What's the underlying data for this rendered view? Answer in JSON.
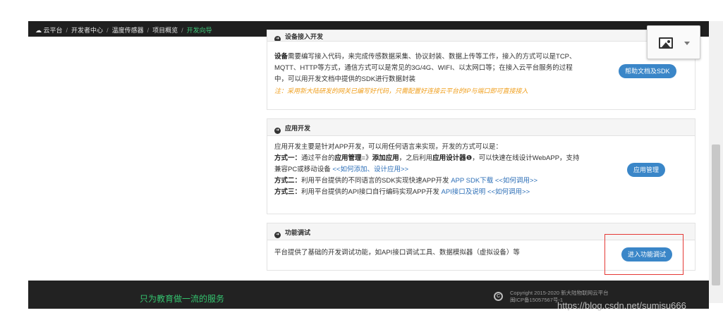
{
  "breadcrumb": {
    "home_icon": "cloud-icon",
    "items": [
      "云平台",
      "开发者中心",
      "温度传感器",
      "项目概览",
      "开发向导"
    ],
    "separator": "/"
  },
  "image_widget": {
    "icon": "image-icon",
    "caret": "caret-down-icon"
  },
  "device_panel": {
    "title": "设备接入开发",
    "lines": [
      {
        "bold": "设备",
        "text": "需要编写接入代码，来完成传感数据采集、协议封装、数据上传等工作，接入的方式可以是TCP、"
      },
      {
        "text": "MQTT、HTTP等方式，通信方式可以是常见的3G/4G、WIFI、以太网口等；在接入云平台服务的过程"
      },
      {
        "text": "中，可以用开发文档中提供的SDK进行数据封装"
      }
    ],
    "note": "注：采用新大陆研发的网关已编写好代码，只需配置好连接云平台的IP与端口即可直接接入",
    "button": "帮助文档及SDK"
  },
  "app_panel": {
    "title": "应用开发",
    "intro": "应用开发主要是针对APP开发，可以用任何语言来实现，开发的方式可以是：",
    "method1": {
      "label": "方式一：",
      "text_a": "通过平台的",
      "link_a": "应用管理",
      "text_b": "=》",
      "link_b": "添加应用",
      "text_c": "，之后利用",
      "bold_c": "应用设计器",
      "text_d": "，可以快速在线设计WebAPP，支持",
      "line2": "兼容PC或移动设备",
      "link_c": "<<如何添加、设计应用>>"
    },
    "method2": {
      "label": "方式二：",
      "text": "利用平台提供的不同语言的SDK实现快速APP开发",
      "link_a": "APP SDK下载",
      "link_b": "<<如何调用>>"
    },
    "method3": {
      "label": "方式三：",
      "text": "利用平台提供的API接口自行编码实现APP开发",
      "link_a": "API接口及说明",
      "link_b": "<<如何调用>>"
    },
    "button": "应用管理"
  },
  "debug_panel": {
    "title": "功能调试",
    "text": "平台提供了基础的开发调试功能，如API接口调试工具、数据模拟器（虚拟设备）等",
    "button": "进入功能调试"
  },
  "footer": {
    "slogan": "只为教育做一流的服务",
    "copyright_line1": "Copyright 2015-2020 新大陆物联网云平台",
    "copyright_line2": "闽ICP备15057567号-1"
  },
  "watermark": "https://blog.csdn.net/sumisu666",
  "colors": {
    "accent_green": "#3fc77a",
    "button_blue": "#3a86c8",
    "highlight_red": "#e53935",
    "note_orange": "#f0a020"
  }
}
